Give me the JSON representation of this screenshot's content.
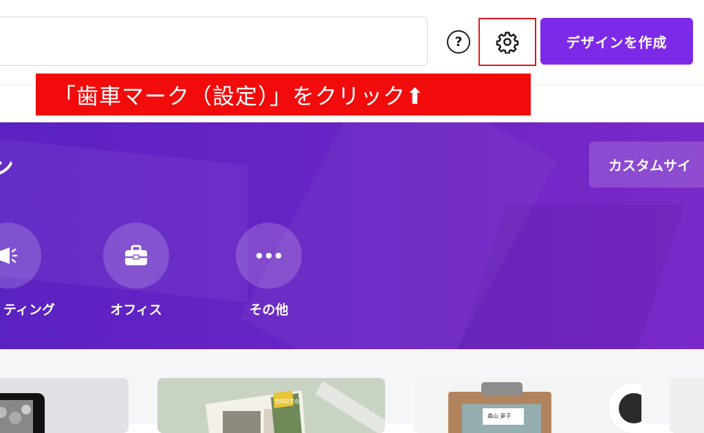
{
  "header": {
    "search_placeholder": "",
    "create_design_label": "デザインを作成",
    "help_icon": "question-circle-icon",
    "settings_icon": "gear-icon",
    "accent_color": "#7d2ae8"
  },
  "annotation": {
    "text": "「歯車マーク（設定）」をクリック⬆",
    "color": "#f20b0b"
  },
  "hero": {
    "title_partial": "ン",
    "custom_size_label": "カスタムサイ",
    "categories": [
      {
        "label": "ティング",
        "icon": "megaphone-icon"
      },
      {
        "label": "オフィス",
        "icon": "briefcase-icon"
      },
      {
        "label": "その他",
        "icon": "more-dots-icon"
      }
    ]
  },
  "cards": {
    "card2_tag": "完成見学会",
    "card3_name": "森山 夢子"
  }
}
